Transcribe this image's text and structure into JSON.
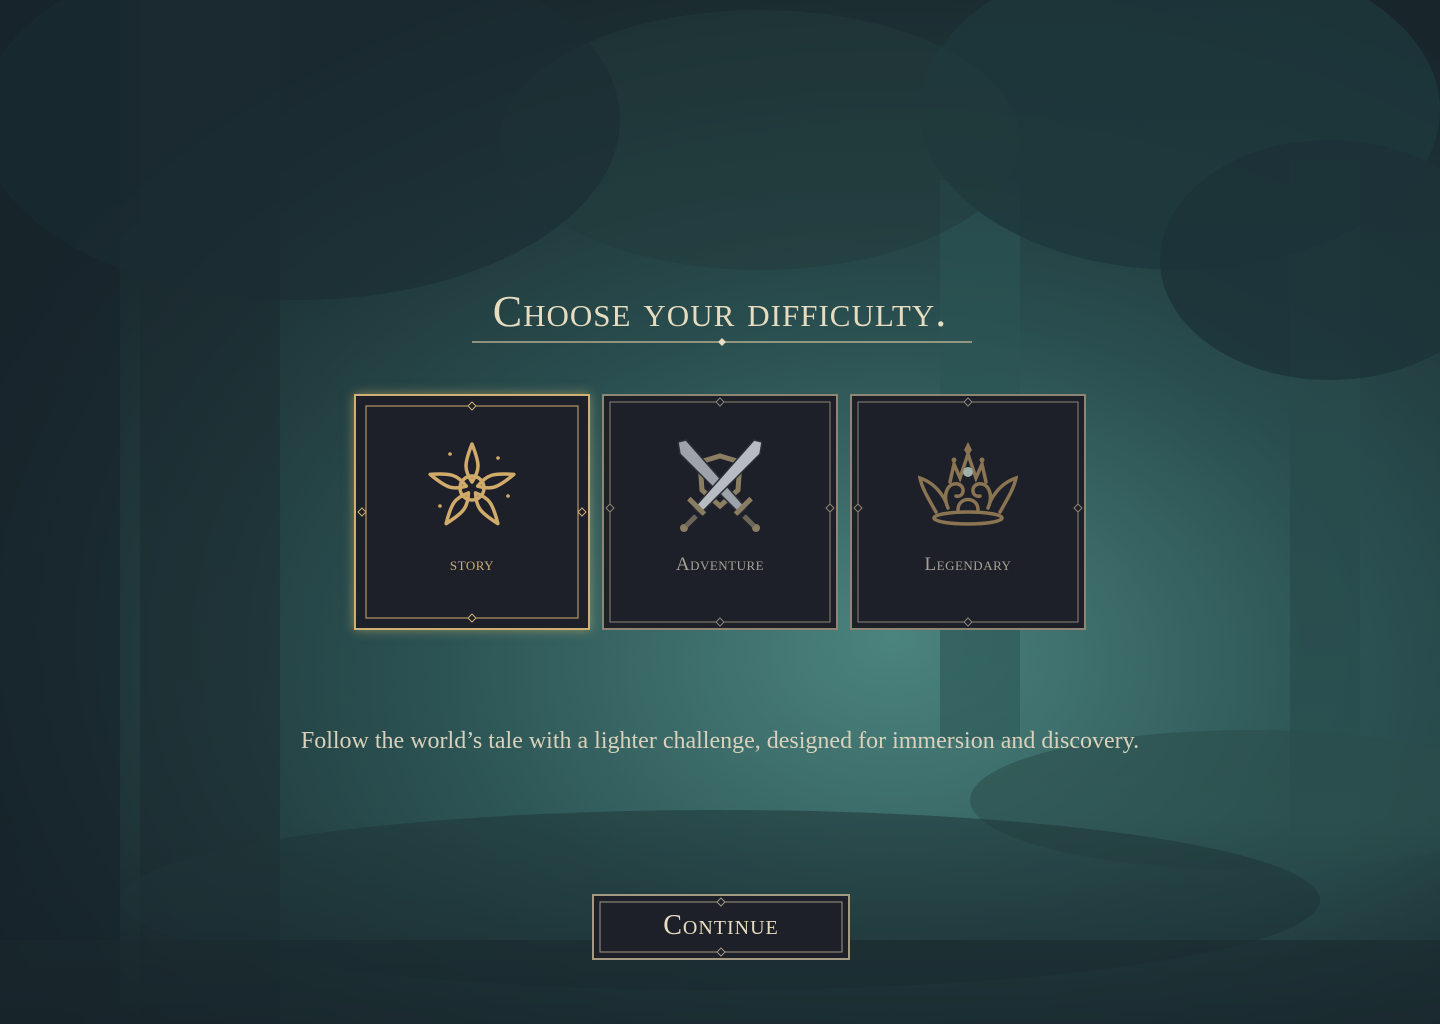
{
  "screen": {
    "title": "Choose your difficulty.",
    "description": "Follow the world’s tale with a lighter challenge, designed for immersion and discovery.",
    "continue_label": "Continue"
  },
  "difficulties": [
    {
      "label": "story",
      "icon": "star-flower-icon",
      "selected": true
    },
    {
      "label": "Adventure",
      "icon": "crossed-swords-icon",
      "selected": false
    },
    {
      "label": "Legendary",
      "icon": "crown-icon",
      "selected": false
    }
  ],
  "colors": {
    "accent_gold": "#cfb074",
    "panel": "#1d2029",
    "text_light": "#e6dcc0",
    "forest_teal": "#2f5a58"
  }
}
